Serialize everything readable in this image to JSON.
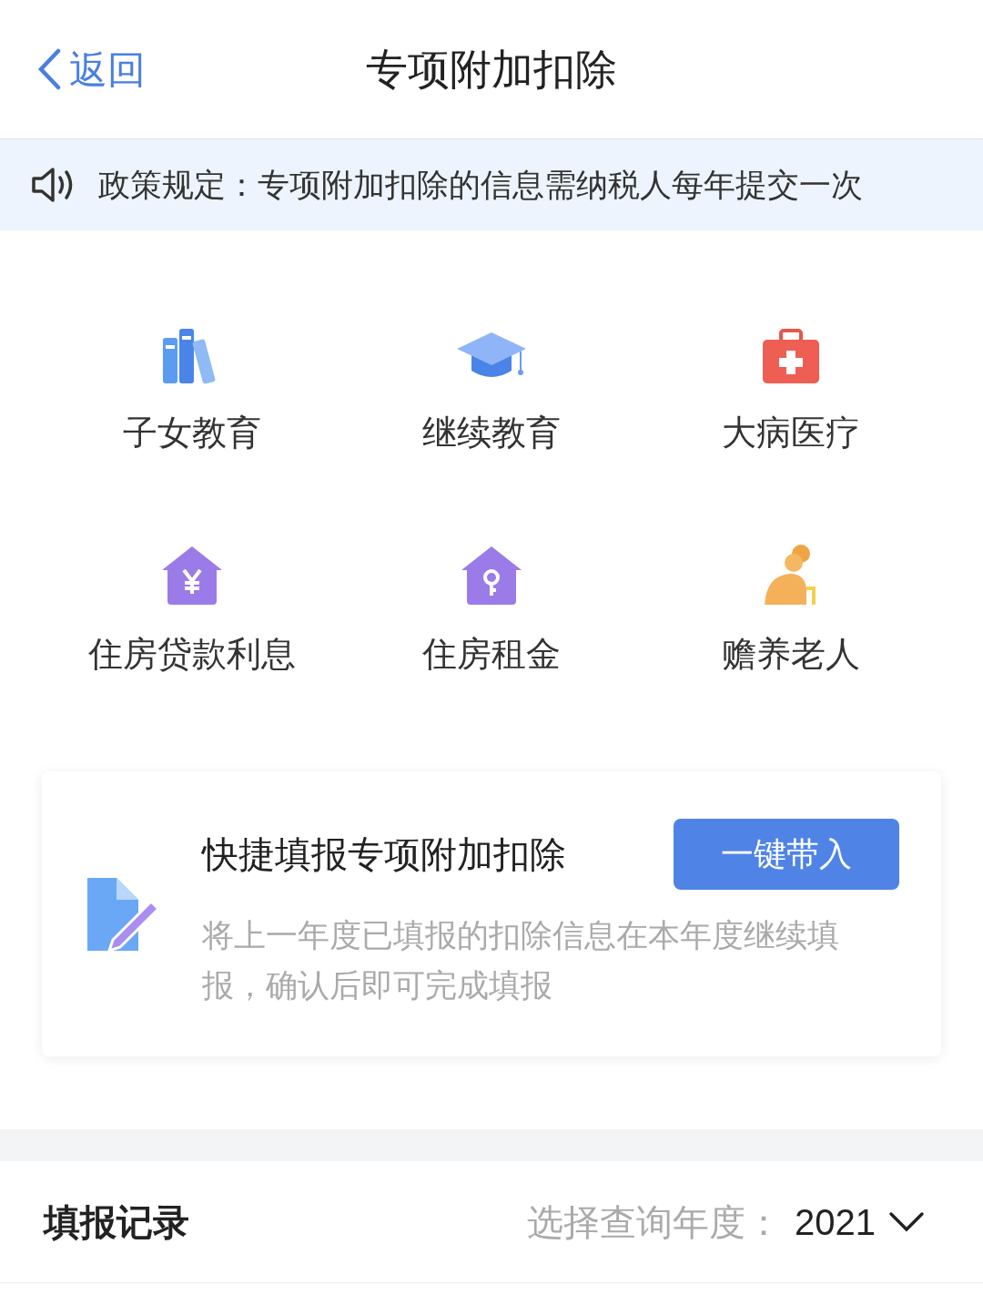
{
  "nav": {
    "back": "返回",
    "title": "专项附加扣除"
  },
  "notice": {
    "text": "政策规定：专项附加扣除的信息需纳税人每年提交一次"
  },
  "categories": [
    {
      "label": "子女教育",
      "kind": "books"
    },
    {
      "label": "继续教育",
      "kind": "cap"
    },
    {
      "label": "大病医疗",
      "kind": "medkit"
    },
    {
      "label": "住房贷款利息",
      "kind": "house_yen"
    },
    {
      "label": "住房租金",
      "kind": "house_key"
    },
    {
      "label": "赡养老人",
      "kind": "elder"
    }
  ],
  "quick_fill": {
    "title": "快捷填报专项附加扣除",
    "button": "一键带入",
    "description": "将上一年度已填报的扣除信息在本年度继续填报，确认后即可完成填报"
  },
  "records": {
    "title": "填报记录",
    "year_label": "选择查询年度：",
    "year": "2021"
  }
}
